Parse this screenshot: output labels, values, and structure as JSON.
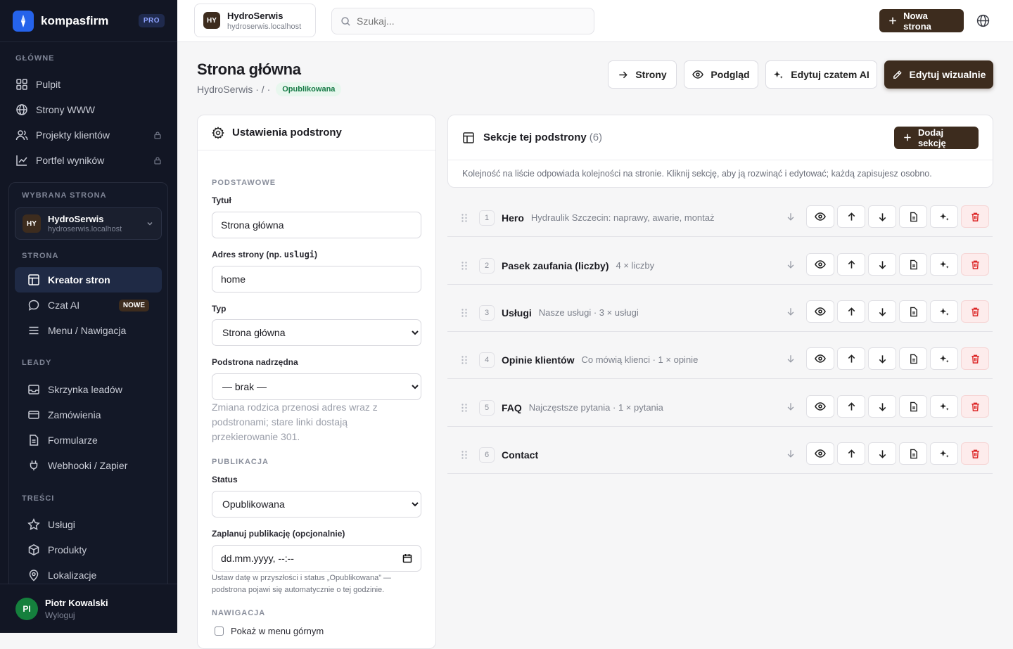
{
  "sidebar": {
    "brand": "kompasfirm",
    "plan_badge": "PRO",
    "main_label": "GŁÓWNE",
    "main_items": [
      {
        "label": "Pulpit",
        "icon": "dashboard-icon"
      },
      {
        "label": "Strony WWW",
        "icon": "globe-icon"
      },
      {
        "label": "Projekty klientów",
        "icon": "users-icon",
        "locked": true
      },
      {
        "label": "Portfel wyników",
        "icon": "chart-line-icon",
        "locked": true
      }
    ],
    "selected_site_label": "WYBRANA STRONA",
    "selected_site": {
      "initials": "HY",
      "name": "HydroSerwis",
      "domain": "hydroserwis.localhost"
    },
    "strona_label": "STRONA",
    "strona_items": [
      {
        "label": "Kreator stron",
        "active": true
      },
      {
        "label": "Czat AI",
        "badge": "NOWE"
      },
      {
        "label": "Menu / Nawigacja"
      }
    ],
    "leady_label": "LEADY",
    "leady_items": [
      {
        "label": "Skrzynka leadów"
      },
      {
        "label": "Zamówienia"
      },
      {
        "label": "Formularze"
      },
      {
        "label": "Webhooki / Zapier"
      }
    ],
    "tresci_label": "TREŚCI",
    "tresci_items": [
      {
        "label": "Usługi"
      },
      {
        "label": "Produkty"
      },
      {
        "label": "Lokalizacje"
      }
    ],
    "user": {
      "initials": "PI",
      "name": "Piotr Kowalski",
      "action": "Wyloguj"
    }
  },
  "topbar": {
    "site": {
      "initials": "HY",
      "name": "HydroSerwis",
      "domain": "hydroserwis.localhost"
    },
    "search_placeholder": "Szukaj...",
    "new_page_label": "Nowa strona"
  },
  "page": {
    "title": "Strona główna",
    "breadcrumb": "HydroSerwis · / ·",
    "status_badge": "Opublikowana",
    "actions": {
      "pages": "Strony",
      "preview": "Podgląd",
      "ai_edit": "Edytuj czatem AI",
      "visual_edit": "Edytuj wizualnie"
    }
  },
  "settings": {
    "header": "Ustawienia podstrony",
    "basic_label": "PODSTAWOWE",
    "title_label": "Tytuł",
    "title_value": "Strona główna",
    "slug_label_prefix": "Adres strony (np. ",
    "slug_label_code": "uslugi",
    "slug_label_suffix": ")",
    "slug_value": "home",
    "type_label": "Typ",
    "type_value": "Strona główna",
    "parent_label": "Podstrona nadrzędna",
    "parent_value": "— brak —",
    "parent_hint": "Zmiana rodzica przenosi adres wraz z podstronami; stare linki dostają przekierowanie 301.",
    "publication_label": "PUBLIKACJA",
    "status_label": "Status",
    "status_value": "Opublikowana",
    "schedule_label": "Zaplanuj publikację (opcjonalnie)",
    "schedule_placeholder": "dd.mm.yyyy, --:--",
    "schedule_hint": "Ustaw datę w przyszłości i status „Opublikowana” — podstrona pojawi się automatycznie o tej godzinie.",
    "nav_label": "NAWIGACJA",
    "show_in_menu_label": "Pokaż w menu górnym"
  },
  "sections": {
    "header": "Sekcje tej podstrony",
    "count": "(6)",
    "add_label": "Dodaj sekcję",
    "description": "Kolejność na liście odpowiada kolejności na stronie. Kliknij sekcję, aby ją rozwinąć i edytować; każdą zapisujesz osobno.",
    "items": [
      {
        "num": "1",
        "title": "Hero",
        "subtitle": "Hydraulik Szczecin: naprawy, awarie, montaż"
      },
      {
        "num": "2",
        "title": "Pasek zaufania (liczby)",
        "subtitle": "4 × liczby"
      },
      {
        "num": "3",
        "title": "Usługi",
        "subtitle": "Nasze usługi · 3 × usługi"
      },
      {
        "num": "4",
        "title": "Opinie klientów",
        "subtitle": "Co mówią klienci · 1 × opinie"
      },
      {
        "num": "5",
        "title": "FAQ",
        "subtitle": "Najczęstsze pytania · 1 × pytania"
      },
      {
        "num": "6",
        "title": "Contact",
        "subtitle": ""
      }
    ]
  },
  "colors": {
    "accent_brown": "#3d2c1e",
    "sidebar_bg": "#121624",
    "brand_blue": "#2563eb",
    "published_green": "#157a45",
    "delete_red": "#dc2626"
  }
}
